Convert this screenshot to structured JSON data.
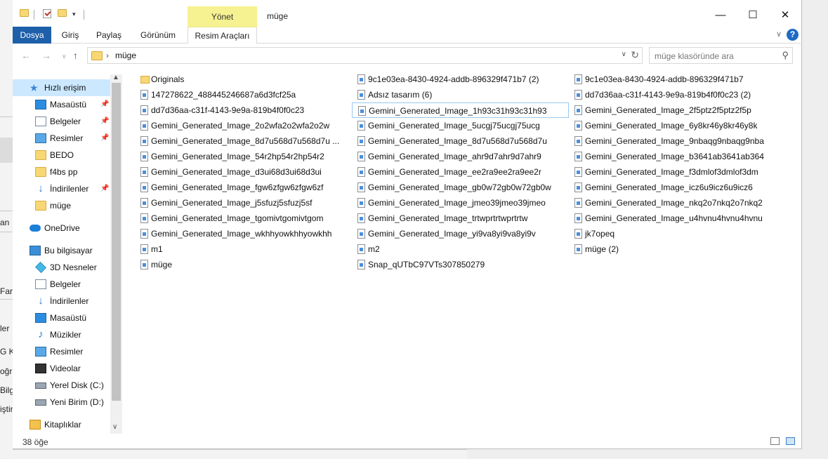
{
  "window": {
    "title": "müge",
    "context_tab_header": "Yönet",
    "controls": {
      "minimize": "—",
      "maximize": "☐",
      "close": "✕"
    }
  },
  "ribbon": {
    "tabs": [
      {
        "label": "Dosya",
        "active": true
      },
      {
        "label": "Giriş"
      },
      {
        "label": "Paylaş"
      },
      {
        "label": "Görünüm"
      },
      {
        "label": "Resim Araçları"
      }
    ],
    "help": "?"
  },
  "address": {
    "path": "müge",
    "search_placeholder": "müge klasöründe ara"
  },
  "background_window": {
    "fragments": [
      "an",
      "Far",
      "ler",
      "G K",
      "oğra",
      "Bilg",
      "iştir"
    ]
  },
  "sidebar": {
    "items": [
      {
        "label": "Hızlı erişim",
        "icon": "star-icon",
        "selected": true
      },
      {
        "label": "Masaüstü",
        "icon": "desktop-icon",
        "pinned": true
      },
      {
        "label": "Belgeler",
        "icon": "documents-icon",
        "pinned": true
      },
      {
        "label": "Resimler",
        "icon": "pictures-icon",
        "pinned": true
      },
      {
        "label": "BEDO",
        "icon": "folder-icon"
      },
      {
        "label": "f4bs pp",
        "icon": "folder-icon"
      },
      {
        "label": "İndirilenler",
        "icon": "download-icon",
        "pinned": true
      },
      {
        "label": "müge",
        "icon": "folder-icon"
      },
      {
        "label": "OneDrive",
        "icon": "cloud-icon"
      },
      {
        "label": "Bu bilgisayar",
        "icon": "computer-icon"
      },
      {
        "label": "3D Nesneler",
        "icon": "3d-objects-icon"
      },
      {
        "label": "Belgeler",
        "icon": "documents-icon"
      },
      {
        "label": "İndirilenler",
        "icon": "download-icon"
      },
      {
        "label": "Masaüstü",
        "icon": "desktop-icon"
      },
      {
        "label": "Müzikler",
        "icon": "music-icon"
      },
      {
        "label": "Resimler",
        "icon": "pictures-icon"
      },
      {
        "label": "Videolar",
        "icon": "videos-icon"
      },
      {
        "label": "Yerel Disk (C:)",
        "icon": "disk-icon"
      },
      {
        "label": "Yeni Birim (D:)",
        "icon": "disk-icon"
      },
      {
        "label": "Kitaplıklar",
        "icon": "libraries-icon"
      }
    ]
  },
  "files": {
    "col1": [
      {
        "name": "Originals",
        "type": "folder"
      },
      {
        "name": "147278622_488445246687a6d3fcf25a",
        "type": "file"
      },
      {
        "name": "dd7d36aa-c31f-4143-9e9a-819b4f0f0c23",
        "type": "file"
      },
      {
        "name": "Gemini_Generated_Image_2o2wfa2o2wfa2o2w",
        "type": "file"
      },
      {
        "name": "Gemini_Generated_Image_8d7u568d7u568d7u ...",
        "type": "file"
      },
      {
        "name": "Gemini_Generated_Image_54r2hp54r2hp54r2",
        "type": "file"
      },
      {
        "name": "Gemini_Generated_Image_d3ui68d3ui68d3ui",
        "type": "file"
      },
      {
        "name": "Gemini_Generated_Image_fgw6zfgw6zfgw6zf",
        "type": "file"
      },
      {
        "name": "Gemini_Generated_Image_j5sfuzj5sfuzj5sf",
        "type": "file"
      },
      {
        "name": "Gemini_Generated_Image_tgomivtgomivtgom",
        "type": "file"
      },
      {
        "name": "Gemini_Generated_Image_wkhhyowkhhyowkhh",
        "type": "file"
      },
      {
        "name": "m1",
        "type": "file"
      },
      {
        "name": "müge",
        "type": "file"
      }
    ],
    "col2": [
      {
        "name": "9c1e03ea-8430-4924-addb-896329f471b7 (2)",
        "type": "file"
      },
      {
        "name": "Adsız tasarım (6)",
        "type": "file"
      },
      {
        "name": "Gemini_Generated_Image_1h93c31h93c31h93",
        "type": "file",
        "focused": true
      },
      {
        "name": "Gemini_Generated_Image_5ucgj75ucgj75ucg",
        "type": "file"
      },
      {
        "name": "Gemini_Generated_Image_8d7u568d7u568d7u",
        "type": "file"
      },
      {
        "name": "Gemini_Generated_Image_ahr9d7ahr9d7ahr9",
        "type": "file"
      },
      {
        "name": "Gemini_Generated_Image_ee2ra9ee2ra9ee2r",
        "type": "file"
      },
      {
        "name": "Gemini_Generated_Image_gb0w72gb0w72gb0w",
        "type": "file"
      },
      {
        "name": "Gemini_Generated_Image_jmeo39jmeo39jmeo",
        "type": "file"
      },
      {
        "name": "Gemini_Generated_Image_trtwprtrtwprtrtw",
        "type": "file"
      },
      {
        "name": "Gemini_Generated_Image_yi9va8yi9va8yi9v",
        "type": "file"
      },
      {
        "name": "m2",
        "type": "file"
      },
      {
        "name": "Snap_qUTbC97VTs307850279",
        "type": "file"
      }
    ],
    "col3": [
      {
        "name": "9c1e03ea-8430-4924-addb-896329f471b7",
        "type": "file"
      },
      {
        "name": "dd7d36aa-c31f-4143-9e9a-819b4f0f0c23 (2)",
        "type": "file"
      },
      {
        "name": "Gemini_Generated_Image_2f5ptz2f5ptz2f5p",
        "type": "file"
      },
      {
        "name": "Gemini_Generated_Image_6y8kr46y8kr46y8k",
        "type": "file"
      },
      {
        "name": "Gemini_Generated_Image_9nbaqg9nbaqg9nba",
        "type": "file"
      },
      {
        "name": "Gemini_Generated_Image_b3641ab3641ab364",
        "type": "file"
      },
      {
        "name": "Gemini_Generated_Image_f3dmlof3dmlof3dm",
        "type": "file"
      },
      {
        "name": "Gemini_Generated_Image_icz6u9icz6u9icz6",
        "type": "file"
      },
      {
        "name": "Gemini_Generated_Image_nkq2o7nkq2o7nkq2",
        "type": "file"
      },
      {
        "name": "Gemini_Generated_Image_u4hvnu4hvnu4hvnu",
        "type": "file"
      },
      {
        "name": "jk7opeq",
        "type": "file"
      },
      {
        "name": "müge (2)",
        "type": "file"
      }
    ]
  },
  "status": {
    "count": "38 öğe"
  }
}
